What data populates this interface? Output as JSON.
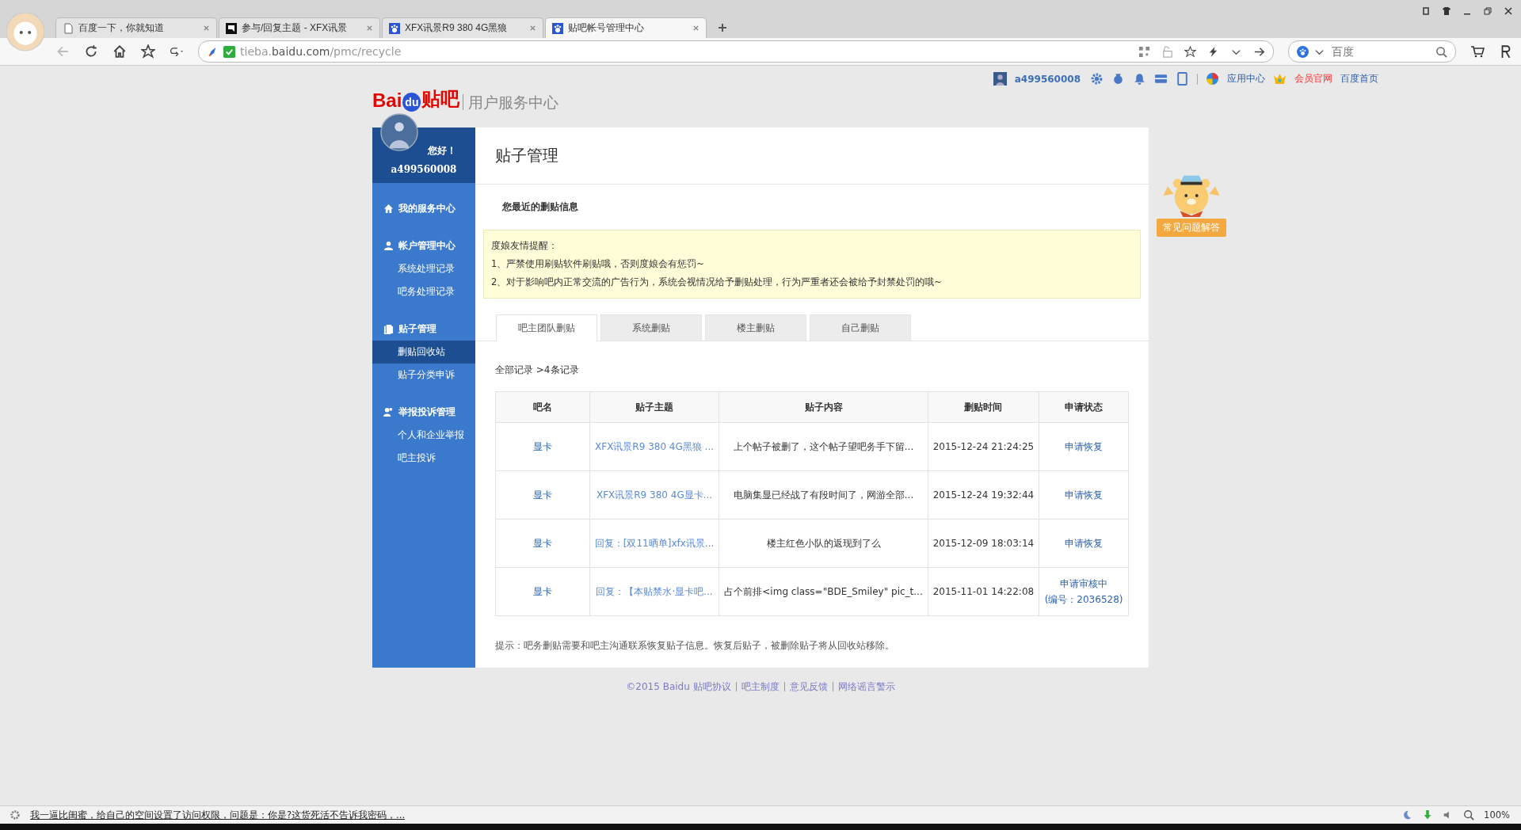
{
  "browser": {
    "tabs": [
      {
        "title": "百度一下，你就知道",
        "selected": false
      },
      {
        "title": "参与/回复主题 - XFX讯景",
        "selected": false
      },
      {
        "title": "XFX讯景R9 380 4G黑狼",
        "selected": false
      },
      {
        "title": "贴吧帐号管理中心",
        "selected": true
      }
    ],
    "address": {
      "prefix": "tieba.",
      "domain": "baidu.com",
      "path": "/pmc/recycle"
    },
    "search_placeholder": "百度"
  },
  "header": {
    "logo": {
      "bai": "Bai",
      "du": "du",
      "tieba": "贴吧"
    },
    "subtitle": "用户服务中心",
    "username": "a499560008",
    "links": [
      {
        "label": "应用中心",
        "kind": "app"
      },
      {
        "label": "会员官网",
        "kind": "vip"
      },
      {
        "label": "百度首页",
        "kind": "plain"
      }
    ]
  },
  "sidebar": {
    "greeting": "您好！",
    "username": "a499560008",
    "sections": [
      {
        "title": "我的服务中心"
      },
      {
        "title": "帐户管理中心",
        "items": [
          {
            "label": "系统处理记录",
            "selected": false
          },
          {
            "label": "吧务处理记录",
            "selected": false
          }
        ]
      },
      {
        "title": "贴子管理",
        "items": [
          {
            "label": "删贴回收站",
            "selected": true
          },
          {
            "label": "贴子分类申诉",
            "selected": false
          }
        ]
      },
      {
        "title": "举报投诉管理",
        "items": [
          {
            "label": "个人和企业举报",
            "selected": false
          },
          {
            "label": "吧主投诉",
            "selected": false
          }
        ]
      }
    ]
  },
  "main": {
    "title": "贴子管理",
    "section_title": "您最近的删贴信息",
    "notice": {
      "title": "度娘友情提醒：",
      "lines": [
        "1、严禁使用刷贴软件刷贴哦，否则度娘会有惩罚~",
        "2、对于影响吧内正常交流的广告行为，系统会视情况给予删贴处理，行为严重者还会被给予封禁处罚的哦~"
      ]
    },
    "tabs": [
      {
        "label": "吧主团队删贴",
        "selected": true
      },
      {
        "label": "系统删贴",
        "selected": false
      },
      {
        "label": "楼主删贴",
        "selected": false
      },
      {
        "label": "自己删贴",
        "selected": false
      }
    ],
    "breadcrumb": "全部记录 >4条记录",
    "table": {
      "columns": [
        "吧名",
        "贴子主题",
        "贴子内容",
        "删贴时间",
        "申请状态"
      ],
      "rows": [
        {
          "forum": "显卡",
          "topic": "XFX讯景R9 380 4G黑狼 ...",
          "content": "上个帖子被删了，这个帖子望吧务手下留...",
          "time": "2015-12-24 21:24:25",
          "status": [
            "申请恢复"
          ]
        },
        {
          "forum": "显卡",
          "topic": "XFX讯景R9 380 4G显卡...",
          "content": "电脑集显已经战了有段时间了，网游全部...",
          "time": "2015-12-24 19:32:44",
          "status": [
            "申请恢复"
          ]
        },
        {
          "forum": "显卡",
          "topic": "回复：[双11晒单]xfx讯景...",
          "content": "楼主红色小队的返现到了么",
          "time": "2015-12-09 18:03:14",
          "status": [
            "申请恢复"
          ]
        },
        {
          "forum": "显卡",
          "topic": "回复：【本贴禁水·显卡吧...",
          "content": "占个前排<img class=\"BDE_Smiley\" pic_t...",
          "time": "2015-11-01 14:22:08",
          "status": [
            "申请审核中",
            "(编号：2036528)"
          ]
        }
      ]
    },
    "hint": "提示：吧务删贴需要和吧主沟通联系恢复贴子信息。恢复后贴子，被删除贴子将从回收站移除。"
  },
  "mascot_label": "常见问题解答",
  "footer": [
    "©2015 Baidu 贴吧协议",
    "吧主制度",
    "意见反馈",
    "网络谣言警示"
  ],
  "status_bar": {
    "message": "我一逼比闺蜜，给自己的空间设置了访问权限，问题是：你是?这货死活不告诉我密码，...",
    "zoom": "100%"
  }
}
